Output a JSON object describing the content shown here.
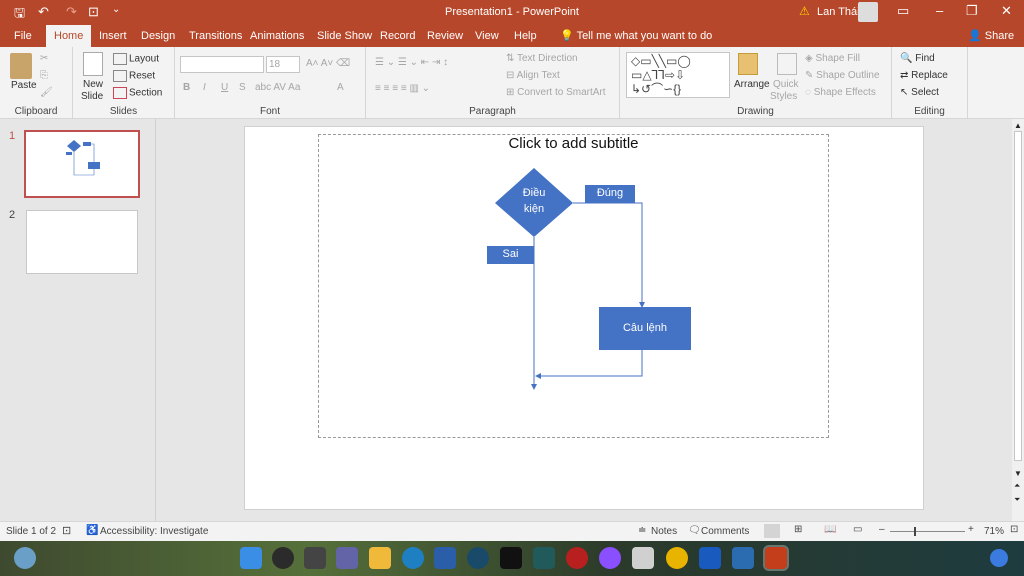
{
  "titlebar": {
    "title": "Presentation1  -  PowerPoint",
    "user": "Lan Thái"
  },
  "tabs": [
    "File",
    "Home",
    "Insert",
    "Design",
    "Transitions",
    "Animations",
    "Slide Show",
    "Record",
    "Review",
    "View",
    "Help"
  ],
  "active_tab": "Home",
  "tellme": "Tell me what you want to do",
  "share": "Share",
  "ribbon": {
    "clipboard": {
      "paste": "Paste",
      "label": "Clipboard"
    },
    "slides": {
      "new_slide": "New",
      "new_slide2": "Slide",
      "layout": "Layout",
      "reset": "Reset",
      "section": "Section",
      "label": "Slides"
    },
    "font": {
      "size": "18",
      "label": "Font"
    },
    "paragraph": {
      "text_direction": "Text Direction",
      "align_text": "Align Text",
      "smartart": "Convert to SmartArt",
      "label": "Paragraph"
    },
    "drawing": {
      "arrange": "Arrange",
      "quick": "Quick",
      "styles": "Styles",
      "shape_fill": "Shape Fill",
      "shape_outline": "Shape Outline",
      "shape_effects": "Shape Effects",
      "label": "Drawing"
    },
    "editing": {
      "find": "Find",
      "replace": "Replace",
      "select": "Select",
      "label": "Editing"
    }
  },
  "thumbs": [
    "1",
    "2"
  ],
  "slide": {
    "subtitle": "Click to add subtitle",
    "condition": "Điều",
    "condition2": "kiện",
    "yes": "Đúng",
    "no": "Sai",
    "statement": "Câu lệnh"
  },
  "status": {
    "slide": "Slide 1 of 2",
    "accessibility": "Accessibility: Investigate",
    "notes": "Notes",
    "comments": "Comments",
    "zoom": "71%"
  },
  "colors": {
    "accent": "#b7472a",
    "shape": "#4472c4"
  }
}
